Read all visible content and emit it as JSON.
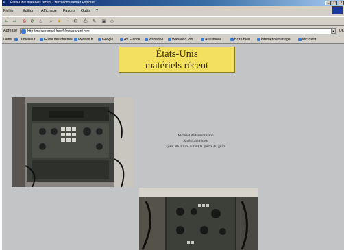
{
  "window": {
    "title": "États-Unis matériels récent - Microsoft Internet Explorer",
    "minimize_icon": "minimize-icon",
    "maximize_icon": "maximize-icon",
    "close_icon": "close-icon"
  },
  "menu": {
    "items": [
      "Fichier",
      "Edition",
      "Affichage",
      "Favoris",
      "Outils",
      "?"
    ]
  },
  "toolbar": {
    "icons": [
      "back-arrow-icon",
      "forward-arrow-icon",
      "stop-icon",
      "refresh-icon",
      "home-icon",
      "search-icon",
      "favorites-icon",
      "history-icon",
      "mail-icon",
      "print-icon",
      "edit-icon",
      "discuss-icon",
      "messenger-icon"
    ]
  },
  "address": {
    "label": "Adresse",
    "url": "http://musee.arnel.free.fr/materecent.htm",
    "go": "OK"
  },
  "links": {
    "label": "Liens",
    "items": [
      "Le meilleur",
      "Guide des chaînes",
      "www.ad.fr",
      "Google",
      "AV France",
      "Wanadoo",
      "Wanadoo Pro",
      "Assistance",
      "Baze Bleu",
      "Internet démarrage",
      "Microsoft"
    ]
  },
  "page": {
    "heading_line1": "États-Unis",
    "heading_line2": "matériels récent",
    "caption_line1": "Matériel de transmission",
    "caption_line2": "Américain récent",
    "caption_line3": "ayant été utilisé durant la guerre du golfe",
    "bg_color": "#c2c4c6",
    "heading_bg": "#f3e05e"
  }
}
